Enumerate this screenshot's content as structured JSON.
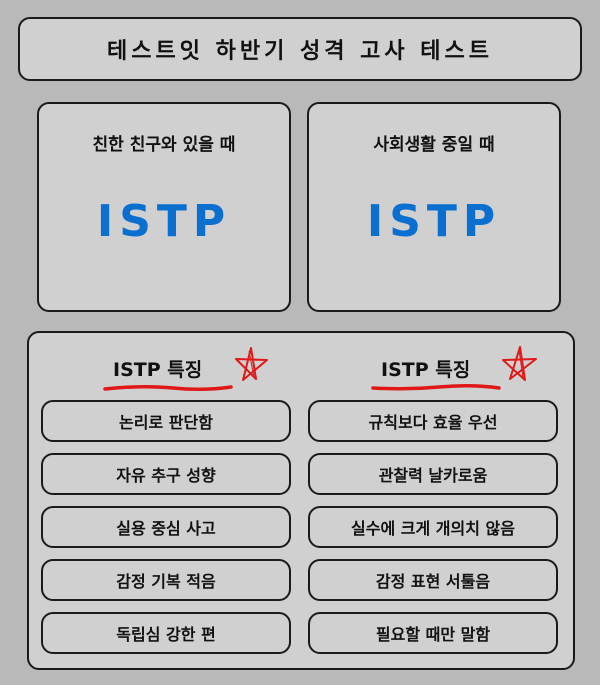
{
  "header": {
    "title": "테스트잇 하반기 성격 고사 테스트"
  },
  "cards": [
    {
      "heading": "친한 친구와 있을 때",
      "type": "ISTP"
    },
    {
      "heading": "사회생활 중일 때",
      "type": "ISTP"
    }
  ],
  "traits": {
    "columns": [
      {
        "header": "ISTP 특징",
        "items": [
          "논리로 판단함",
          "자유 추구 성향",
          "실용 중심 사고",
          "감정 기복 적음",
          "독립심 강한 편"
        ]
      },
      {
        "header": "ISTP 특징",
        "items": [
          "규칙보다 효율 우선",
          "관찰력 날카로움",
          "실수에 크게 개의치 않음",
          "감정 표현 서툴음",
          "필요할 때만 말함"
        ]
      }
    ]
  },
  "colors": {
    "background": "#b9b9b9",
    "panel": "#d0d0d0",
    "border": "#1a1a1a",
    "type_accent": "#0b6fd0",
    "doodle_red": "#e01818"
  },
  "icons": {
    "header_decoration": "star-doodle-icon"
  }
}
